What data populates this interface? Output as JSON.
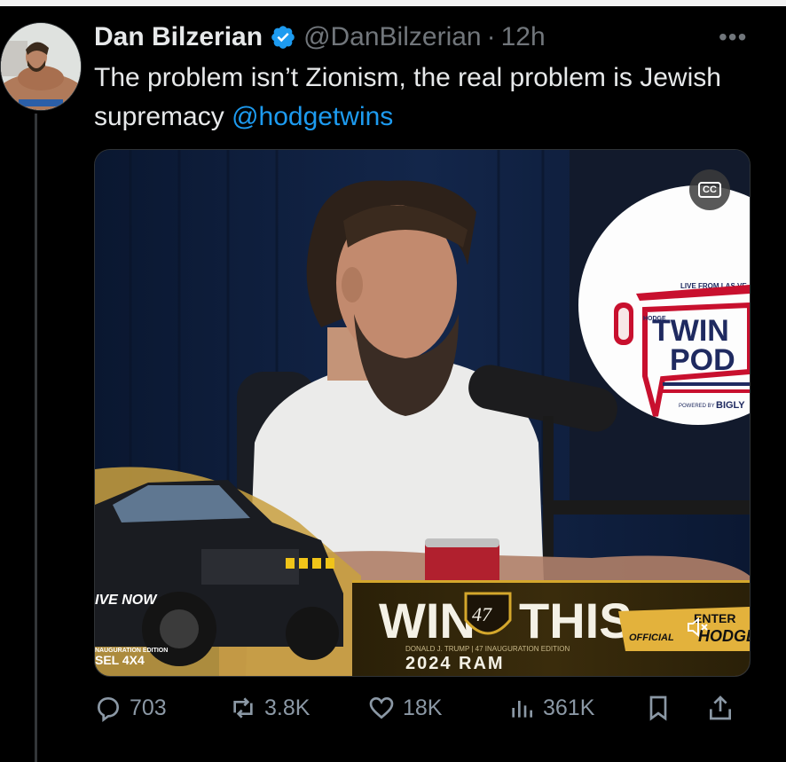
{
  "tweet": {
    "author_name": "Dan Bilzerian",
    "handle": "@DanBilzerian",
    "separator": "·",
    "time": "12h",
    "more_icon": "ellipsis-icon",
    "text_part1": "The problem isn’t Zionism, the real problem is Jewish supremacy ",
    "mention": "@hodgetwins"
  },
  "media": {
    "type": "video",
    "cc_label": "CC",
    "banner_win": "WIN",
    "banner_47": "47",
    "banner_this": "THIS",
    "banner_sub": "DONALD J. TRUMP | 47 INAUGURATION EDITION",
    "banner_ram": "2024 RAM",
    "left_live": "IVE NOW",
    "left_inauguration": "NAUGURATION EDITION",
    "left_model": "SEL 4X4",
    "enter_label": "ENTER",
    "official_label": "OFFICIAL",
    "official_partial": "HODGE",
    "logo_top": "LIVE FROM LAS VE",
    "logo_hodge": "HODGE",
    "logo_twin": "TWIN",
    "logo_pod": "POD",
    "logo_powered": "POWERED BY",
    "logo_bigly": "BIGLY",
    "mute_icon": "speaker-muted-icon",
    "colors": {
      "banner_gold": "#d4a72c",
      "logo_red": "#c8102e",
      "logo_navy": "#1f2a60"
    }
  },
  "actions": {
    "replies": "703",
    "reposts": "3.8K",
    "likes": "18K",
    "views": "361K"
  },
  "colors": {
    "accent": "#1d9bf0",
    "background": "#000000",
    "text": "#e7e9ea",
    "muted": "#71767b"
  }
}
